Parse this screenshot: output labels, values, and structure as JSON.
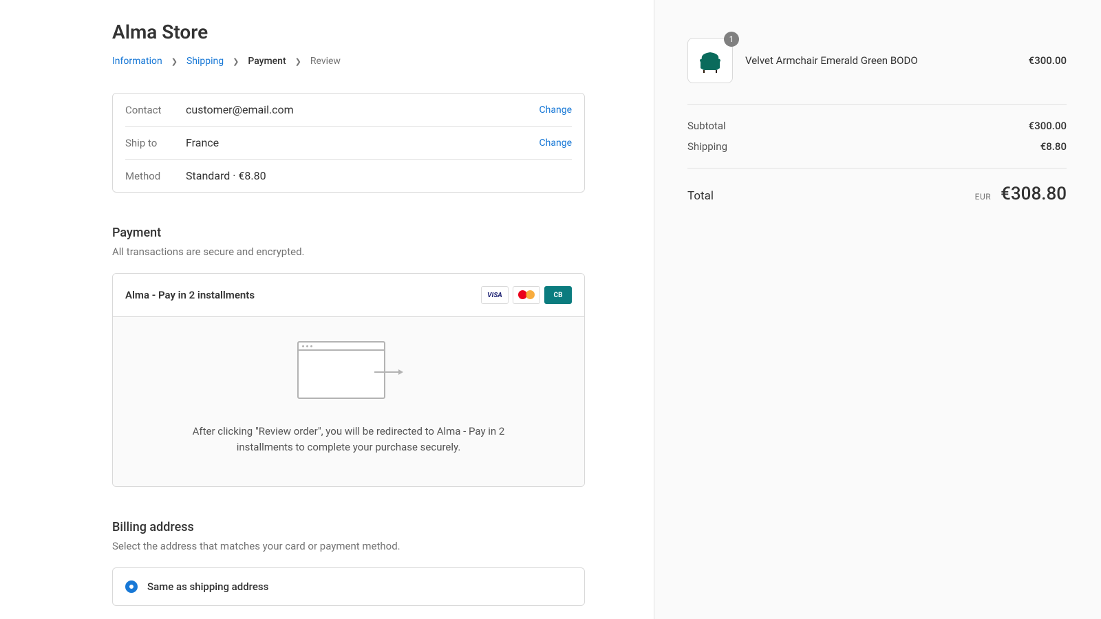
{
  "store_name": "Alma Store",
  "breadcrumb": {
    "information": "Information",
    "shipping": "Shipping",
    "payment": "Payment",
    "review": "Review"
  },
  "review": {
    "contact_label": "Contact",
    "contact_value": "customer@email.com",
    "shipto_label": "Ship to",
    "shipto_value": "France",
    "method_label": "Method",
    "method_value": "Standard · €8.80",
    "change": "Change"
  },
  "payment": {
    "heading": "Payment",
    "subheading": "All transactions are secure and encrypted.",
    "option_title": "Alma - Pay in 2 installments",
    "cards": {
      "visa": "VISA",
      "cb": "CB"
    },
    "redirect_text": "After clicking \"Review order\", you will be redirected to Alma - Pay in 2 installments to complete your purchase securely."
  },
  "billing": {
    "heading": "Billing address",
    "subheading": "Select the address that matches your card or payment method.",
    "same_label": "Same as shipping address"
  },
  "summary": {
    "product": {
      "qty": "1",
      "name": "Velvet Armchair Emerald Green BODO",
      "price": "€300.00"
    },
    "subtotal_label": "Subtotal",
    "subtotal_value": "€300.00",
    "shipping_label": "Shipping",
    "shipping_value": "€8.80",
    "total_label": "Total",
    "currency": "EUR",
    "total_value": "€308.80"
  }
}
